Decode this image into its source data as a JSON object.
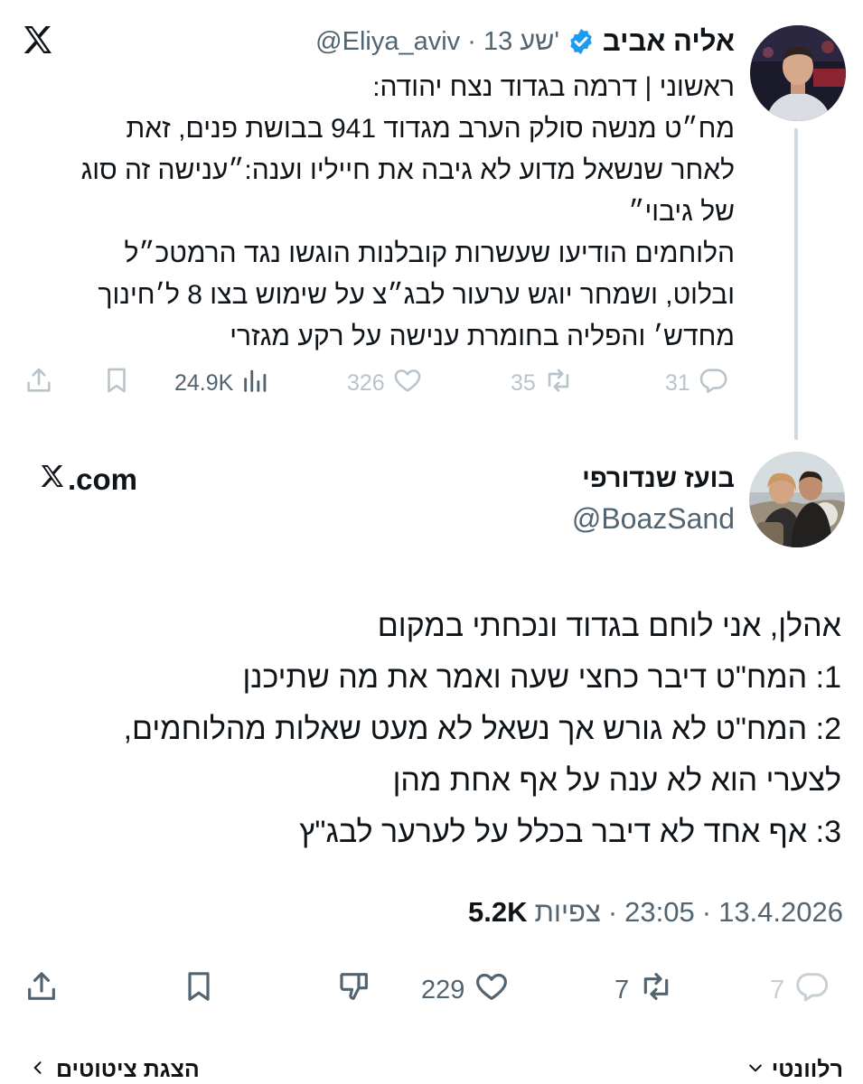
{
  "quoted_tweet": {
    "author_name": "אליה אביב",
    "handle_meta": "@Eliya_aviv · 13 שע'",
    "lines": [
      "ראשוני | דרמה בגדוד נצח יהודה:",
      "מח״ט מנשה סולק הערב מגדוד 941 בבושת פנים, זאת",
      "לאחר שנשאל מדוע לא גיבה את חייליו וענה:״ענישה זה סוג",
      "של גיבוי״",
      "הלוחמים הודיעו שעשרות קובלנות הוגשו נגד הרמטכ״ל",
      "ובלוט, ושמחר יוגש ערעור לבג״צ על שימוש בצו 8 ל׳חינוך",
      "מחדש׳ והפליה בחומרת ענישה על רקע מגזרי"
    ],
    "stats": {
      "replies": "31",
      "retweets": "35",
      "likes": "326",
      "views": "24.9K"
    },
    "icons": [
      "x-logo-icon",
      "verified-badge-icon",
      "reply-icon",
      "retweet-icon",
      "like-icon",
      "views-icon",
      "bookmark-icon",
      "share-icon"
    ]
  },
  "main_tweet": {
    "author_name": "בועז שנדורפי",
    "handle": "@BoazSand",
    "site_label": ".com",
    "lines": [
      "אהלן, אני לוחם בגדוד ונכחתי במקום",
      "1: המח\"ט דיבר כחצי שעה ואמר את מה שתיכנן",
      "2: המח\"ט לא גורש אך נשאל לא מעט שאלות מהלוחמים,",
      "לצערי הוא לא ענה על אף אחת מהן",
      "3: אף אחד לא דיבר בכלל על לערער לבג\"ץ"
    ],
    "date": "13.4.2026",
    "time": "23:05",
    "views_label": "צפיות",
    "views_count": "5.2K",
    "stats": {
      "replies": "7",
      "retweets": "7",
      "likes": "229"
    }
  },
  "bottom_bar": {
    "left_label": "הצגת ציטוטים",
    "right_label": "רלוונטי"
  },
  "colors": {
    "text": "#0f1419",
    "secondary": "#536471",
    "faded": "#b9c3ca",
    "verified": "#1d9bf0",
    "thread_line": "#cfd9de"
  }
}
